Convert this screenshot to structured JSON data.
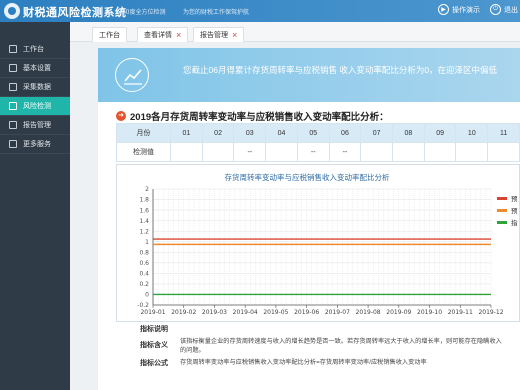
{
  "app": {
    "title": "财税通风险检测系统",
    "slogan_1": "360度全方位检测",
    "slogan_2": "为您的财税工作保驾护航",
    "actions": [
      {
        "label": "操作演示",
        "icon": "play-icon"
      },
      {
        "label": "退出",
        "icon": "power-icon"
      }
    ]
  },
  "sidebar": {
    "items": [
      {
        "label": "工作台",
        "icon": "monitor-icon",
        "active": false
      },
      {
        "label": "基本设置",
        "icon": "edit-icon",
        "active": false
      },
      {
        "label": "采集数据",
        "icon": "data-icon",
        "active": false
      },
      {
        "label": "风险检测",
        "icon": "check-icon",
        "active": true
      },
      {
        "label": "报告管理",
        "icon": "report-icon",
        "active": false
      },
      {
        "label": "更多服务",
        "icon": "grid-icon",
        "active": false
      }
    ]
  },
  "tabs": [
    {
      "label": "工作台",
      "closable": false
    },
    {
      "label": "查看详情",
      "closable": true
    },
    {
      "label": "报告管理",
      "closable": true
    }
  ],
  "banner": {
    "text": "您截止06月得累计存货周转率与应税销售 收入变动率配比分析为0，在迎泽区中偏低"
  },
  "section": {
    "title": "2019各月存货周转率变动率与应税销售收入变动率配比分析："
  },
  "table": {
    "row_header": "月份",
    "months": [
      "01",
      "02",
      "03",
      "04",
      "05",
      "06",
      "07",
      "08",
      "09",
      "10",
      "11"
    ],
    "value_label": "检测值",
    "values": [
      "",
      "",
      "--",
      "",
      "--",
      "--",
      "",
      "",
      "",
      "",
      ""
    ]
  },
  "chart_data": {
    "type": "line",
    "title": "存货周转率变动率与应税销售收入变动率配比分析",
    "categories": [
      "2019-01",
      "2019-02",
      "2019-03",
      "2019-04",
      "2019-05",
      "2019-06",
      "2019-07",
      "2019-08",
      "2019-09",
      "2019-10",
      "2019-11",
      "2019-12"
    ],
    "yticks": [
      "2",
      "1.8",
      "1.6",
      "1.4",
      "1.2",
      "1",
      "0.8",
      "0.6",
      "0.4",
      "0.2",
      "0",
      "-0.2"
    ],
    "ylim": [
      -0.2,
      2
    ],
    "series": [
      {
        "name": "预",
        "color": "#d9432f",
        "values": [
          1.05,
          1.05,
          1.05,
          1.05,
          1.05,
          1.05,
          1.05,
          1.05,
          1.05,
          1.05,
          1.05,
          1.05
        ]
      },
      {
        "name": "预",
        "color": "#f08a2e",
        "values": [
          0.95,
          0.95,
          0.95,
          0.95,
          0.95,
          0.95,
          0.95,
          0.95,
          0.95,
          0.95,
          0.95,
          0.95
        ]
      },
      {
        "name": "指",
        "color": "#2fa23a",
        "values": [
          0,
          0,
          0,
          0,
          0,
          0,
          0,
          0,
          0,
          0,
          0,
          0
        ]
      }
    ],
    "grid": true,
    "legend": "right"
  },
  "info": {
    "heading": "指标说明",
    "meaning_label": "指标含义",
    "meaning_text_1": "该指标衡量企业的存货周转速度与收入的增长趋势是否一致。若存货周转率远大于收入的增长率，则可能存在隐瞒收入",
    "meaning_text_2": "的问题。",
    "formula_label": "指标公式",
    "formula_text": "存货周转率变动率与应税销售收入变动率配比分析=存货周转率变动率/应税销售收入变动率"
  }
}
